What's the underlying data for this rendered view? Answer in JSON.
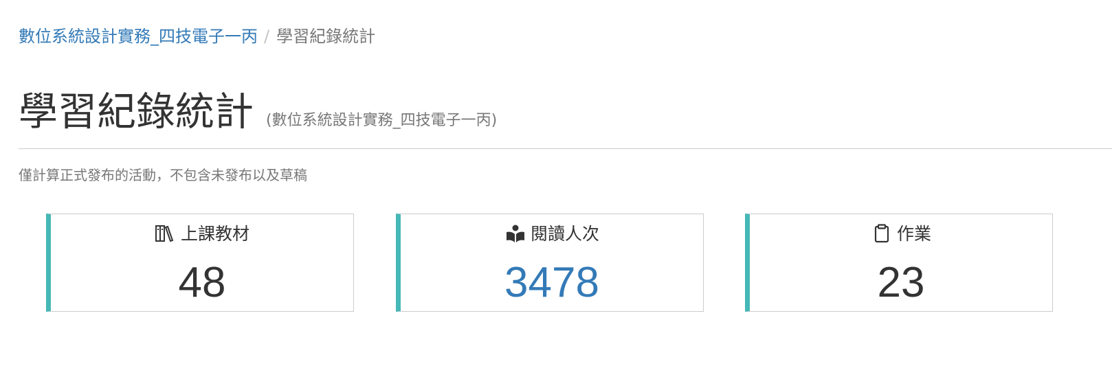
{
  "breadcrumb": {
    "course_link": "數位系統設計實務_四技電子一丙",
    "separator": "/",
    "current": "學習紀錄統計"
  },
  "header": {
    "title": "學習紀錄統計",
    "subtitle": "(數位系統設計實務_四技電子一丙)"
  },
  "note": "僅計算正式發布的活動，不包含未發布以及草稿",
  "cards": [
    {
      "title": "上課教材",
      "value": "48",
      "icon": "books-icon"
    },
    {
      "title": "閱讀人次",
      "value": "3478",
      "icon": "reader-icon"
    },
    {
      "title": "作業",
      "value": "23",
      "icon": "clipboard-icon"
    }
  ],
  "colors": {
    "accent": "#46b8b7",
    "link": "#337ab7",
    "muted": "#777777",
    "text": "#333333"
  }
}
